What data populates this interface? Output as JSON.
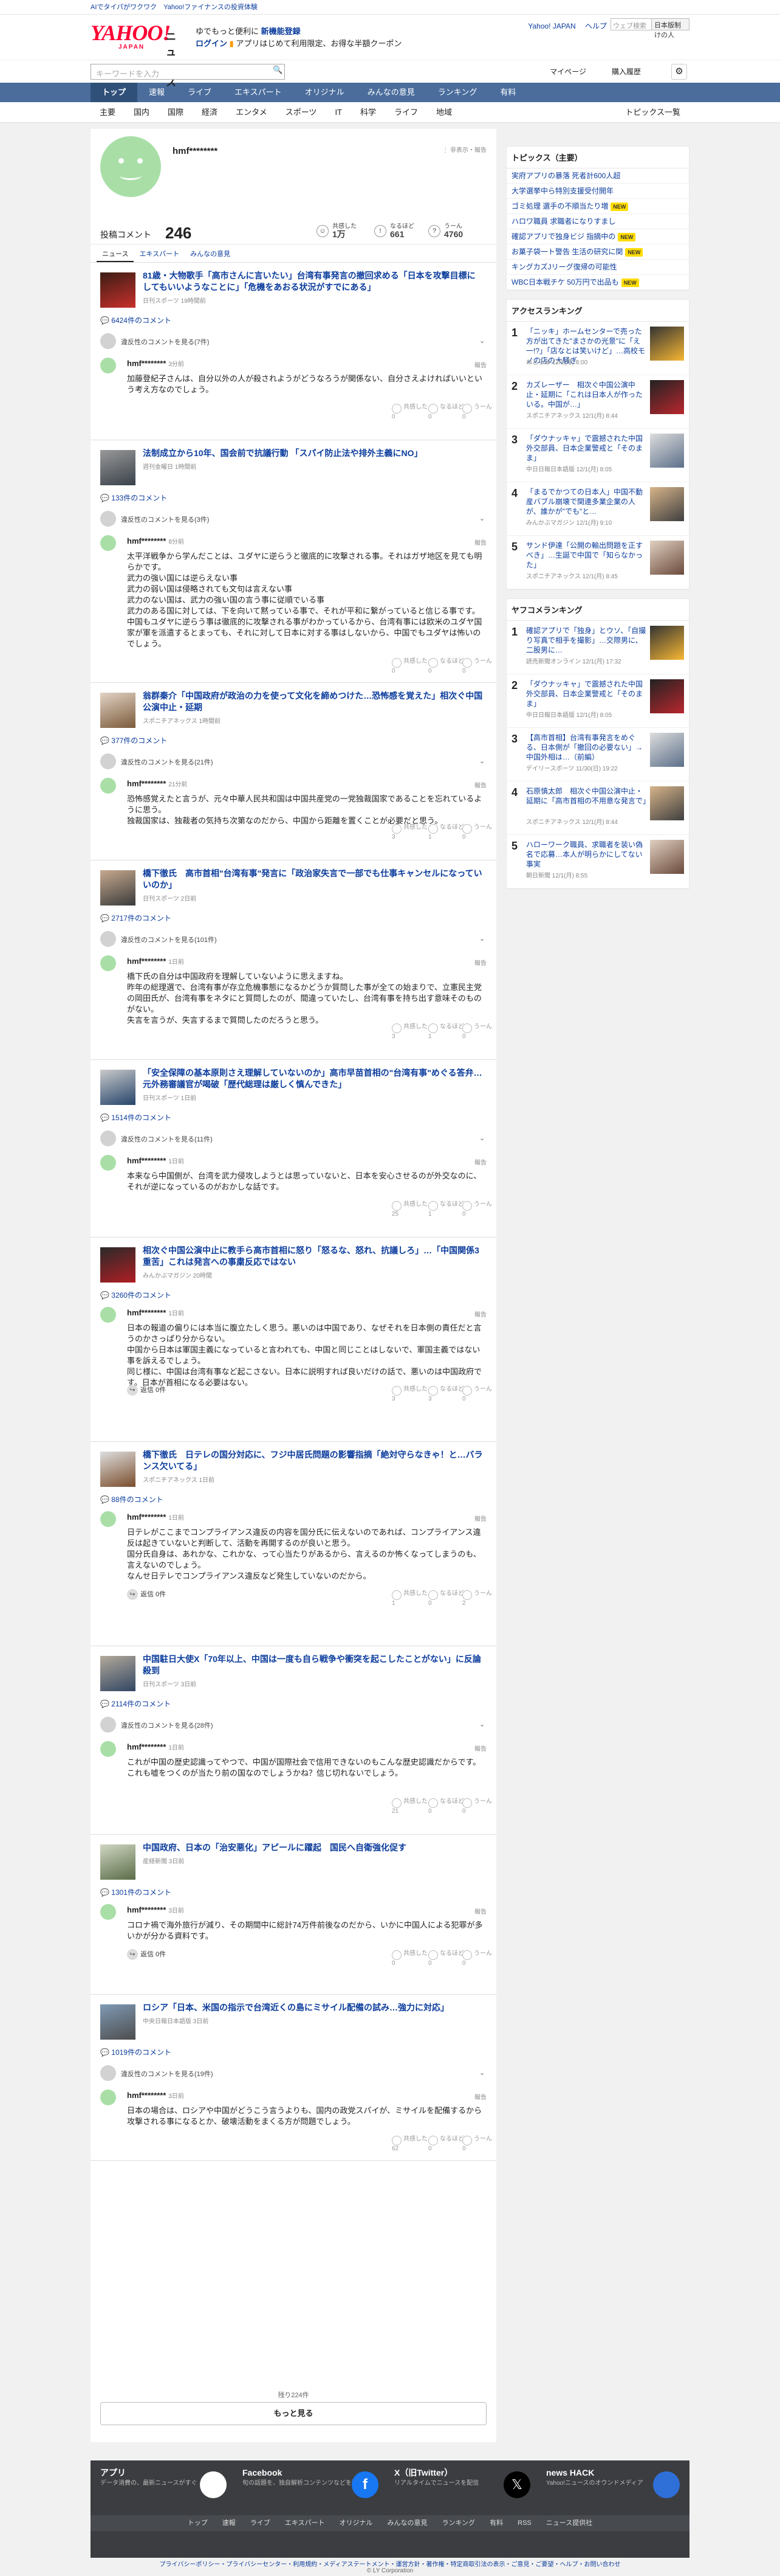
{
  "topbar": {
    "left1": "AIでタイパがワクワク",
    "left2": "Yahoo!ファイナンスの投資体験"
  },
  "header": {
    "logo": "YAHOO!",
    "logo_sub": "JAPAN",
    "logo_news": "ニュース",
    "promo1": "ゆでもっと便利に",
    "promo1b": "新機能登録",
    "promo2": "ログイン",
    "promo2b": "アプリはじめて利用限定、お得な半額クーポン",
    "link1": "Yahoo! JAPAN",
    "link2": "ヘルプ",
    "search_placeholder": "ウェブ検索",
    "search_btn": "日本版制 けの人"
  },
  "search": {
    "placeholder": "キーワードを入力",
    "mypage": "マイページ",
    "buyhist": "購入履歴",
    "gear": "⚙"
  },
  "gnav": [
    "トップ",
    "速報",
    "ライブ",
    "エキスパート",
    "オリジナル",
    "みんなの意見",
    "ランキング",
    "有料"
  ],
  "cnav": [
    "主要",
    "国内",
    "国際",
    "経済",
    "エンタメ",
    "スポーツ",
    "IT",
    "科学",
    "ライフ",
    "地域"
  ],
  "topics_list": "トピックス一覧",
  "profile": {
    "name": "hmf********",
    "menu": "非表示・報告",
    "comments_label": "投稿コメント",
    "comments": "246",
    "like_label": "共感した",
    "like": "1万",
    "nare_label": "なるほど",
    "nare": "661",
    "hmm_label": "うーん",
    "hmm": "4760"
  },
  "tabs": [
    "ニュース",
    "エキスパート",
    "みんなの意見"
  ],
  "articles": [
    {
      "title": "81歳・大物歌手「高市さんに言いたい」台湾有事発言の撤回求める「日本を攻撃目標にしてもいいようなことに」「危機をあおる状況がすでにある」",
      "src": "日刊スポーツ 19時間前",
      "count": "6424件のコメント",
      "bad": "違反性のコメントを見る(7件)",
      "user": "hmf********",
      "time": "3分前",
      "text": "加藤登紀子さんは、自分以外の人が殺されようがどうなろうが関係ない、自分さえよければいいという考え方なのでしょう。",
      "a": "0",
      "b": "0",
      "c": "0"
    },
    {
      "title": "法制成立から10年、国会前で抗議行動 「スパイ防止法や排外主義にNO」",
      "src": "週刊金曜日 1時間前",
      "count": "133件のコメント",
      "bad": "違反性のコメントを見る(3件)",
      "user": "hmf********",
      "time": "8分前",
      "text": "太平洋戦争から学んだことは、ユダヤに逆らうと徹底的に攻撃される事。それはガザ地区を見ても明らかです。\n武力の強い国には逆らえない事\n武力の弱い国は侵略されても文句は言えない事\n武力のない国は、武力の強い国の言う事に従順でいる事\n武力のある国に対しては、下を向いて黙っている事で、それが平和に繋がっていると信じる事です。\n中国もユダヤに逆らう事は徹底的に攻撃される事がわかっているから、台湾有事には欧米のユダヤ国家が軍を派遣するとまっても、それに対して日本に対する事はしないから、中国でもユダヤは怖いのでしょう。",
      "a": "0",
      "b": "0",
      "c": "0"
    },
    {
      "title": "翁群秦介「中国政府が政治の力を使って文化を締めつけた…恐怖感を覚えた」相次ぐ中国公演中止・延期",
      "src": "スポニチアネックス 1時間前",
      "count": "377件のコメント",
      "bad": "違反性のコメントを見る(21件)",
      "user": "hmf********",
      "time": "21分前",
      "text": "恐怖感覚えたと言うが、元々中華人民共和国は中国共産党の一党独裁国家であることを忘れているように思う。\n独裁国家は、独裁者の気持ち次第なのだから、中国から距離を置くことが必要だと思う。",
      "a": "3",
      "b": "1",
      "c": "0"
    },
    {
      "title": "橋下徹氏　高市首相\"台湾有事\"発言に「政治家失言で一部でも仕事キャンセルになっていいのか」",
      "src": "日刊スポーツ 2日前",
      "count": "2717件のコメント",
      "bad": "違反性のコメントを見る(101件)",
      "user": "hmf********",
      "time": "1日前",
      "text": "橋下氏の自分は中国政府を理解していないように思えますね。\n昨年の総理選で、台湾有事が存立危機事態になるかどうか質問した事が全ての始まりで、立憲民主党の岡田氏が、台湾有事をネタにと質問したのが、間違っていたし、台湾有事を持ち出す意味そのものがない。\n失言を言うが、失言するまで質問したのだろうと思う。",
      "a": "3",
      "b": "1",
      "c": "0"
    },
    {
      "title": "「安全保障の基本原則さえ理解していないのか」高市早苗首相の\"台湾有事\"めぐる答弁…元外務審議官が喝破「歴代総理は厳しく慎んできた」",
      "src": "日刊スポーツ 1日前",
      "count": "1514件のコメント",
      "bad": "違反性のコメントを見る(11件)",
      "user": "hmf********",
      "time": "1日前",
      "text": "本来なら中国側が、台湾を武力侵攻しようとは思っていないと、日本を安心させるのが外交なのに、それが逆になっているのがおかしな話です。",
      "a": "25",
      "b": "1",
      "c": "0"
    },
    {
      "title": "相次ぐ中国公演中止に教手ら高市首相に怒り「怒るな、怒れ、抗議しろ」…「中国関係3重苦」これは発言への事粛反応ではない",
      "src": "みんかぶマガジン 20時間",
      "count": "3260件のコメント",
      "bad": "",
      "user": "hmf********",
      "time": "1日前",
      "text": "日本の報道の偏りには本当に腹立たしく思う。悪いのは中国であり、なぜそれを日本側の責任だと言うのかさっぱり分からない。\n中国から日本は軍国主義になっていると言われても、中国と同じことはしないで、軍国主義ではない事を訴えるでしょう。\n同じ様に、中国は台湾有事など起こさない。日本に説明すれば良いだけの話で、悪いのは中国政府です。日本が首相になる必要はない。",
      "reply": "返信 0件",
      "a": "3",
      "b": "3",
      "c": "0"
    },
    {
      "title": "橋下徹氏　日テレの国分対応に、フジ中居氏問題の影響指摘「絶対守らなきゃ！と…バランス欠いてる」",
      "src": "スポニチアネックス 1日前",
      "count": "88件のコメント",
      "bad": "",
      "user": "hmf********",
      "time": "1日前",
      "text": "日テレがここまでコンプライアンス違反の内容を国分氏に伝えないのであれば、コンプライアンス違反は起きていないと判断して、活動を再開するのが良いと思う。\n国分氏自身は、あれかな、これかな、って心当たりがあるから、言えるのか怖くなってしまうのも、言えないのでしょう。\nなんせ日テレでコンプライアンス違反など発生していないのだから。",
      "reply": "返信 0件",
      "a": "1",
      "b": "0",
      "c": "2"
    },
    {
      "title": "中国駐日大使X「70年以上、中国は一度も自ら戦争や衝突を起こしたことがない」に反論殺到",
      "src": "日刊スポーツ 3日前",
      "count": "2114件のコメント",
      "bad": "違反性のコメントを見る(28件)",
      "user": "hmf********",
      "time": "1日前",
      "text": "これが中国の歴史認識ってやつで、中国が国際社会で信用できないのもこんな歴史認識だからです。\nこれも嘘をつくのが当たり前の国なのでしょうかね？信じ切れないでしょう。",
      "a": "21",
      "b": "0",
      "c": "0"
    },
    {
      "title": "中国政府、日本の「治安悪化」アピールに躍起　国民へ自衛強化促す",
      "src": "産経新聞 3日前",
      "count": "1301件のコメント",
      "bad": "",
      "user": "hmf********",
      "time": "3日前",
      "text": "コロナ禍で海外旅行が減り、その期間中に総計74万件前後なのだから、いかに中国人による犯罪が多いかが分かる資料です。",
      "reply": "返信 0件",
      "a": "0",
      "b": "0",
      "c": "0"
    },
    {
      "title": "ロシア「日本、米国の指示で台湾近くの島にミサイル配備の試み…強力に対応」",
      "src": "中央日報日本語版 3日前",
      "count": "1019件のコメント",
      "bad": "違反性のコメントを見る(19件)",
      "user": "hmf********",
      "time": "3日前",
      "text": "日本の場合は、ロシアや中国がどうこう言うよりも、国内の政党スパイが、ミサイルを配備するから攻撃される事になるとか、破壊活動をまくる方が問題でしょう。",
      "a": "62",
      "b": "0",
      "c": "0"
    }
  ],
  "more_count": "残り224件",
  "more_btn": "もっと見る",
  "sidebar": {
    "topics_title": "トピックス（主要）",
    "topics": [
      {
        "t": "実府アプリの暴落 死者計600人超",
        "b": ""
      },
      {
        "t": "大学選挙中ら特別支援受付開年",
        "b": ""
      },
      {
        "t": "ゴミ処理 選手の不順当たり増",
        "b": "NEW"
      },
      {
        "t": "ハロワ職員 求職者になりすまし",
        "b": ""
      },
      {
        "t": "確認アプリで独身ビジ 指摘中の",
        "b": "NEW"
      },
      {
        "t": "お菓子袋一ト警告 生活の研究に関",
        "b": "NEW"
      },
      {
        "t": "キングカズJリーグ復帰の可能性",
        "b": ""
      },
      {
        "t": "WBC日本戦チケ 50万円で出品も",
        "b": "NEW"
      }
    ],
    "rank_title": "アクセスランキング",
    "ranks": [
      {
        "n": "1",
        "t": "「ニッキ」ホームセンターで売った方が出てきた\"まさかの光景\"に「え一!?」「店なとは笑いけど」…高校モノの店の大騒ぎ",
        "s": "ねとらぼ 12/1(月) 8:00"
      },
      {
        "n": "2",
        "t": "カズレーザー　相次ぐ中国公演中止・延期に「これは日本人が作ったいる。中国が…」",
        "s": "スポニチアネックス 12/1(月) 8:44"
      },
      {
        "n": "3",
        "t": "「ダウナッキャ」で震撼された中国外交部員、日本企業警戒と「そのまま」",
        "s": "中日日報日本語版 12/1(月) 8:05"
      },
      {
        "n": "4",
        "t": "「まるでかつての日本人」中国不動産バブル崩壊で関連多業企業の人が、誰かが\"でも\"と…",
        "s": "みんかぶマガジン 12/1(月) 9:10"
      },
      {
        "n": "5",
        "t": "サンド伊達「公開の輸出問題を正すべき」…生誕で中国で「知らなかった」",
        "s": "スポニチアネックス 12/1(月) 8:45"
      }
    ],
    "ranks2_title": "ヤフコメランキング",
    "ranks2": [
      {
        "n": "1",
        "t": "確認アプリで「独身」とウソ、「自撮り写真で相手を撮影」…交際男に、二股男に…",
        "s": "読売新聞オンライン 12/1(月) 17:32"
      },
      {
        "n": "2",
        "t": "「ダウナッキャ」で震撼された中国外交部員、日本企業警戒と「そのまま」",
        "s": "中日日報日本語版 12/1(月) 8:05"
      },
      {
        "n": "3",
        "t": "【高市首相】台湾有事発言をめぐる、日本側が「撤回の必要ない」→中国外相は…（前編）",
        "s": "デイリースポーツ 11/30(日) 19:22"
      },
      {
        "n": "4",
        "t": "石原慎太郎　相次ぐ中国公演中止・延期に「高市首相の不用意な発言で」",
        "s": "スポニチアネックス 12/1(月) 8:44"
      },
      {
        "n": "5",
        "t": "ハローワーク職員、求職者を装い偽名で応募…本人が明らかにしてない事実",
        "s": "朝日新聞 12/1(月) 8:55"
      }
    ]
  },
  "footer": {
    "app_title": "アプリ",
    "app_desc": "データ消費の、最新ニュースがすぐ",
    "fb_title": "Facebook",
    "fb_desc": "旬の話題を、独自解析コンテンツなどを配信",
    "x_title": "X（旧Twitter）",
    "x_desc": "リアルタイムでニュースを配信",
    "hack_title": "news HACK",
    "hack_desc": "Yahoo!ニュースのオウンドメディア",
    "nav": [
      "トップ",
      "速報",
      "ライブ",
      "エキスパート",
      "オリジナル",
      "みんなの意見",
      "ランキング",
      "有料",
      "RSS",
      "ニュース提供社"
    ],
    "links": "プライバシーポリシー・プライバシーセンター・利用規約・メディアステートメント・運営方針・著作権・特定商取引法の表示・ご意見・ご要望・ヘルプ・お問い合わせ",
    "copy": "© LY Corporation"
  }
}
